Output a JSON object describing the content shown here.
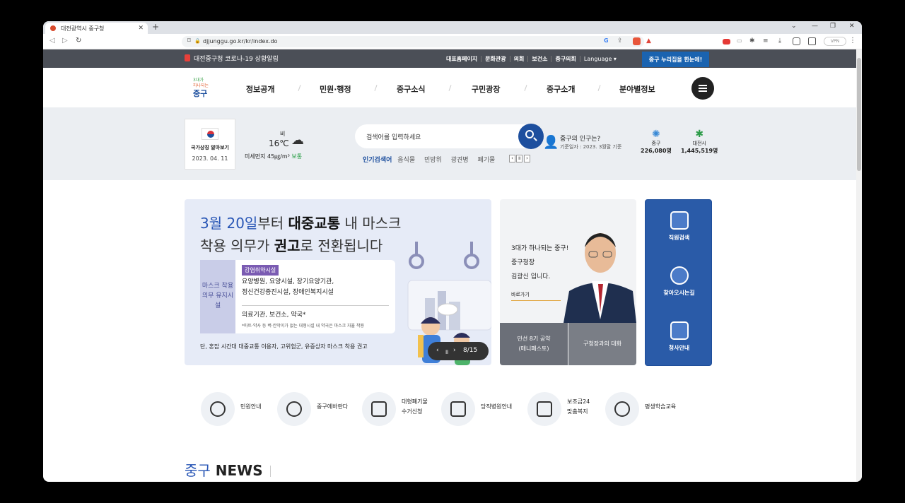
{
  "browser": {
    "tab_title": "대전광역시 중구청",
    "url": "djjunggu.go.kr/kr/index.do",
    "vpn": "VPN"
  },
  "util": {
    "covid": "대전중구청 코로나-19 상황알림",
    "links": [
      "대표홈페이지",
      "문화관광",
      "의회",
      "보건소",
      "중구의회"
    ],
    "language": "Language",
    "nuri": "중구 누리집을 한눈에!"
  },
  "logo": {
    "text": "중구"
  },
  "gnb": [
    "정보공개",
    "민원·행정",
    "중구소식",
    "구민광장",
    "중구소개",
    "분야별정보"
  ],
  "flag": {
    "label": "국가상징 알아보기",
    "date": "2023. 04. 11"
  },
  "weather": {
    "condition": "비",
    "temp": "16℃",
    "dust": "미세먼지 45㎍/m³",
    "dust_level": "보통",
    "icon": "rain-cloud-icon"
  },
  "search": {
    "placeholder": "검색어를 입력하세요",
    "popular_label": "인기검색어",
    "popular": [
      "음식물",
      "민방위",
      "광견병",
      "폐기물"
    ]
  },
  "population": {
    "question": "중구의 인구는?",
    "date": "기준일자 : 2023. 3월말 기준",
    "junggu_name": "중구",
    "junggu_count": "226,080명",
    "daejeon_name": "대전시",
    "daejeon_count": "1,445,519명"
  },
  "banner": {
    "line1_a": "3월 20일",
    "line1_b": "부터 ",
    "line1_c": "대중교통",
    "line1_d": " 내 마스크",
    "line2_a": "착용 의무가 ",
    "line2_b": "권고",
    "line2_c": "로 전환됩니다",
    "side": "마스크 착용의무 유지시설",
    "tag": "감염취약시설",
    "list1": "요양병원, 요양시설, 장기요양기관,",
    "list2": "정신건강증진시설, 장애인복지시설",
    "list3": "의료기관, 보건소, 약국*",
    "note": "*마트·약사 등 벽·칸막이가 없는 대형시설 내 약국은 마스크 자율 착용",
    "foot": "단, 혼잡 시간대 대중교통 이용자, 고위험군, 유증상자 마스크 착용 권고",
    "pager": "8/15"
  },
  "mayor": {
    "line1": "3대가 하나되는 중구!",
    "line2": "중구청장",
    "line3": "김광신 입니다.",
    "go": "바로가기",
    "btn1_a": "민선 8기 공약",
    "btn1_b": "(매니페스토)",
    "btn2": "구청장과의 대화"
  },
  "quick": [
    "직원검색",
    "찾아오시는길",
    "청사안내"
  ],
  "services": [
    {
      "label": "민원안내",
      "icon": "person-icon"
    },
    {
      "label": "중구에바란다",
      "icon": "chat-icon"
    },
    {
      "label": "대형폐기물 수거신청",
      "icon": "monitor-icon"
    },
    {
      "label": "당직병원안내",
      "icon": "hospital-icon"
    },
    {
      "label": "보조금24 맞춤복지",
      "icon": "document-icon"
    },
    {
      "label": "평생학습교육",
      "icon": "graduate-icon"
    }
  ],
  "news": {
    "a": "중구",
    "b": "NEWS"
  }
}
